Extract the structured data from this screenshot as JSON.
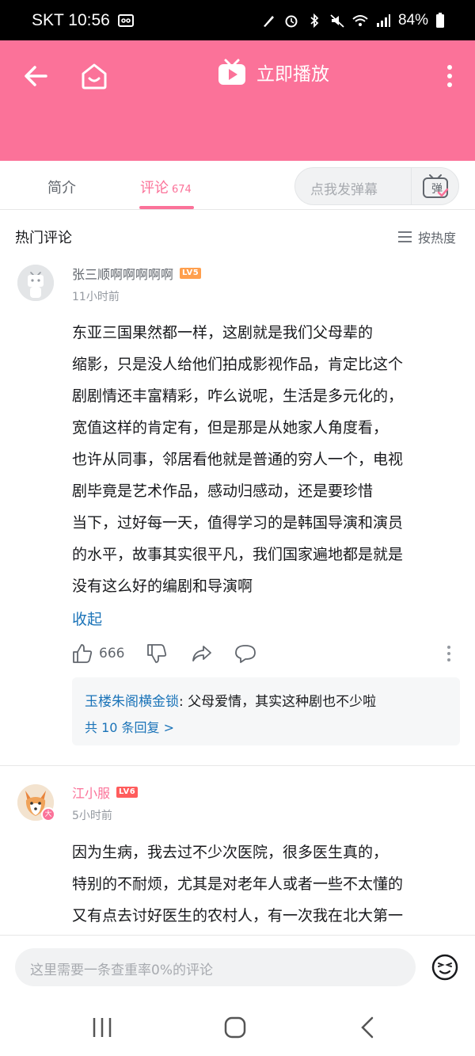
{
  "status_bar": {
    "carrier_time": "SKT 10:56",
    "battery": "84%"
  },
  "header": {
    "play_label": "立即播放",
    "icons": [
      "back-arrow-icon",
      "home-icon",
      "tv-play-icon",
      "more-vertical-icon"
    ]
  },
  "tabs": {
    "intro_label": "简介",
    "comments_label": "评论",
    "comments_count": "674",
    "danmaku_placeholder": "点我发弹幕",
    "danmaku_icon_text": "弹"
  },
  "comments_section": {
    "title": "热门评论",
    "sort_label": "按热度"
  },
  "comments": [
    {
      "username": "张三顺啊啊啊啊啊",
      "level": "LV5",
      "time": "11小时前",
      "lines": [
        "东亚三国果然都一样，这剧就是我们父母辈的",
        "缩影，只是没人给他们拍成影视作品，肯定比这个",
        "剧剧情还丰富精彩，咋么说呢，生活是多元化的，",
        "宽值这样的肯定有，但是那是从她家人角度看，",
        "也许从同事，邻居看他就是普通的穷人一个，电视",
        "剧毕竟是艺术作品，感动归感动，还是要珍惜",
        "当下，过好每一天，值得学习的是韩国导演和演员",
        "的水平，故事其实很平凡，我们国家遍地都是就是",
        "没有这么好的编剧和导演啊"
      ],
      "collapse_label": "收起",
      "like_count": "666",
      "reply_preview": {
        "author": "玉楼朱阁横金锁",
        "text": ": 父母爱情，其实这种剧也不少啦",
        "more_label": "共 10 条回复 >"
      }
    },
    {
      "username": "江小服",
      "level": "LV6",
      "badge": "大",
      "time": "5小时前",
      "lines": [
        "因为生病，我去过不少次医院，很多医生真的，",
        "特别的不耐烦，尤其是对老年人或者一些不太懂的",
        "又有点去讨好医生的农村人，有一次我在北大第一"
      ]
    }
  ],
  "bottom_input": {
    "placeholder": "这里需要一条查重率0%的评论"
  },
  "colors": {
    "brand_pink": "#fb7299",
    "link_blue": "#1a73b8",
    "lv5": "#ff9f4d",
    "lv6": "#ff5c5c"
  }
}
